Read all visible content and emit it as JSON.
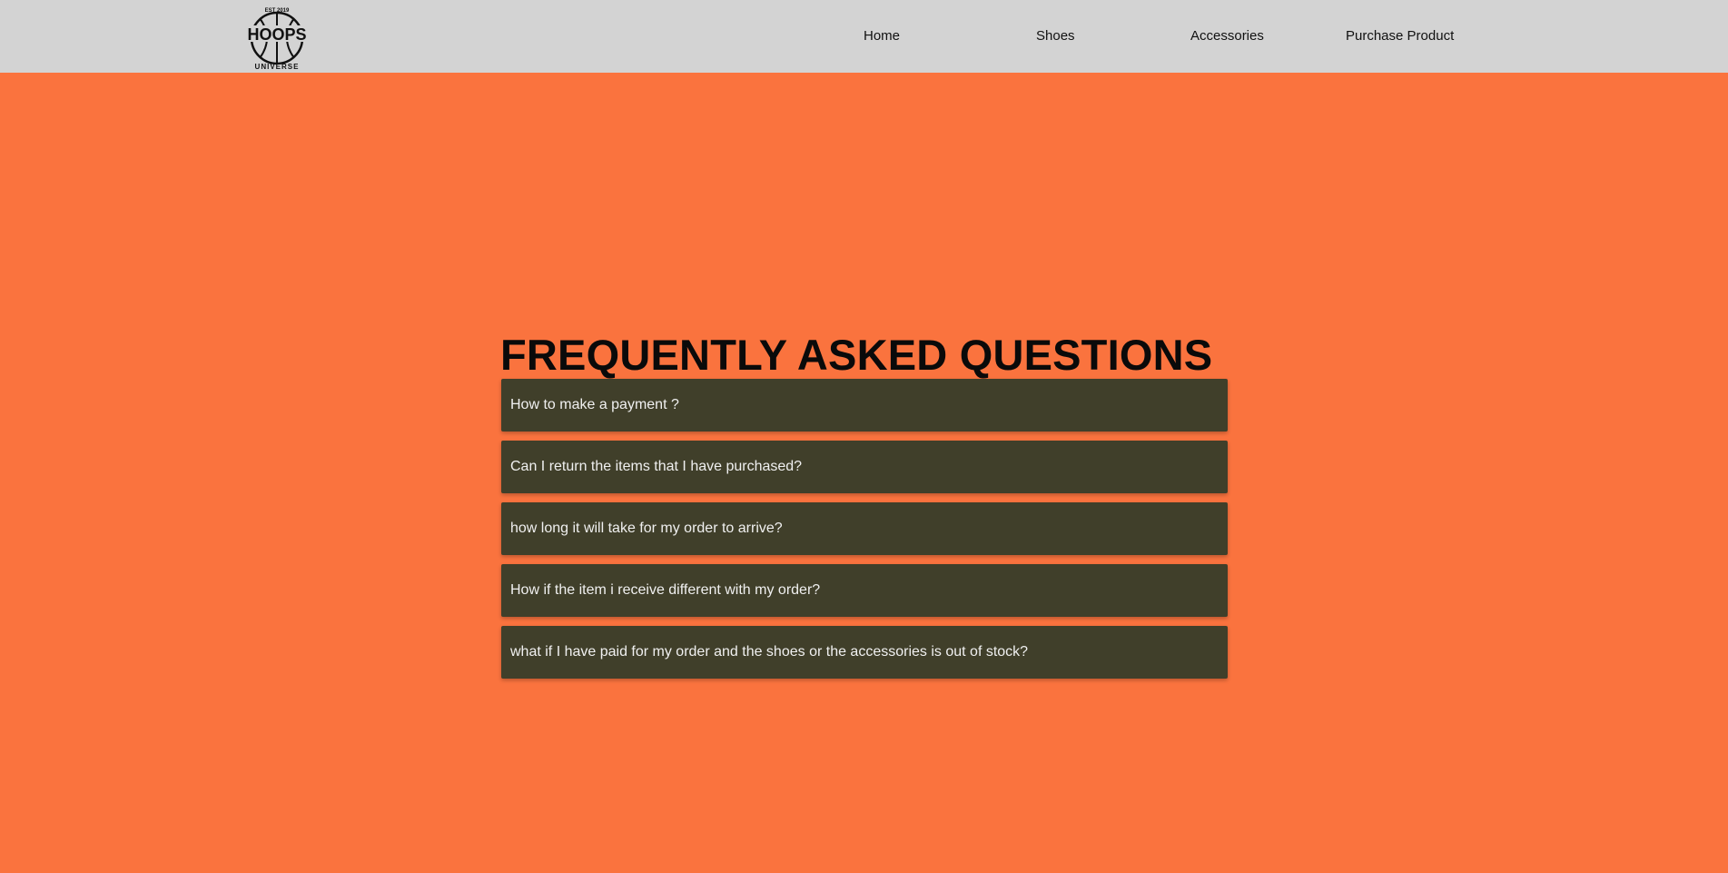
{
  "brand": {
    "logo_text": "HOOPS",
    "logo_subtext_top": "EST 2019",
    "logo_subtext_bottom": "UNIVERSE",
    "icon": "basketball-logo"
  },
  "nav": {
    "home": "Home",
    "shoes": "Shoes",
    "accessories": "Accessories",
    "purchase": "Purchase Product"
  },
  "faq": {
    "title": "FREQUENTLY ASKED QUESTIONS",
    "questions": [
      "How to make a payment ?",
      "Can I return the items that I have purchased?",
      "how long it will take for my order to arrive?",
      "How if the item i receive different with my order?",
      "what if I have paid for my order and the shoes or the accessories is out of stock?"
    ]
  },
  "colors": {
    "navbar_bg": "#d3d3d3",
    "page_bg": "#fa733e",
    "faq_item_bg": "#403f2a",
    "faq_text": "#f0f0f0"
  }
}
